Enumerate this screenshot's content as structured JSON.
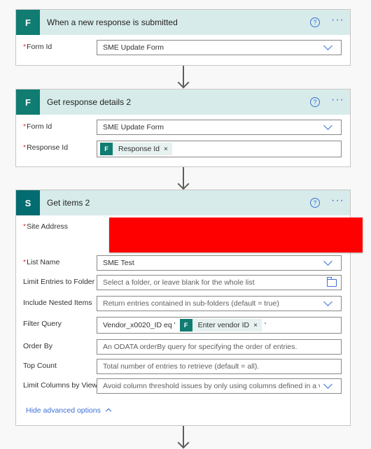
{
  "cards": [
    {
      "title": "When a new response is submitted",
      "fields": [
        {
          "label": "Form Id",
          "value": "SME Update Form"
        }
      ]
    },
    {
      "title": "Get response details 2",
      "fields": [
        {
          "label": "Form Id",
          "value": "SME Update Form"
        },
        {
          "label": "Response Id",
          "token": "Response Id"
        }
      ]
    },
    {
      "title": "Get items 2",
      "fields": {
        "site_address": "Site Address",
        "list_name": {
          "label": "List Name",
          "value": "SME Test"
        },
        "limit_folder": {
          "label": "Limit Entries to Folder",
          "placeholder": "Select a folder, or leave blank for the whole list"
        },
        "nested": {
          "label": "Include Nested Items",
          "placeholder": "Return entries contained in sub-folders (default = true)"
        },
        "filter": {
          "label": "Filter Query",
          "prefix": "Vendor_x0020_ID eq '",
          "token": "Enter vendor ID",
          "suffix": "'"
        },
        "order_by": {
          "label": "Order By",
          "placeholder": "An ODATA orderBy query for specifying the order of entries."
        },
        "top_count": {
          "label": "Top Count",
          "placeholder": "Total number of entries to retrieve (default = all)."
        },
        "limit_columns": {
          "label": "Limit Columns by View",
          "placeholder": "Avoid column threshold issues by only using columns defined in a view"
        }
      },
      "advanced_link": "Hide advanced options"
    }
  ],
  "required_marker": "*",
  "help_glyph": "?",
  "more_glyph": "···",
  "close_glyph": "×",
  "icons": {
    "forms": "forms-icon",
    "sharepoint": "sharepoint-icon"
  },
  "colors": {
    "header_bg": "#d7ecea",
    "accent": "#3b6fd8",
    "redaction": "#ff0000"
  }
}
